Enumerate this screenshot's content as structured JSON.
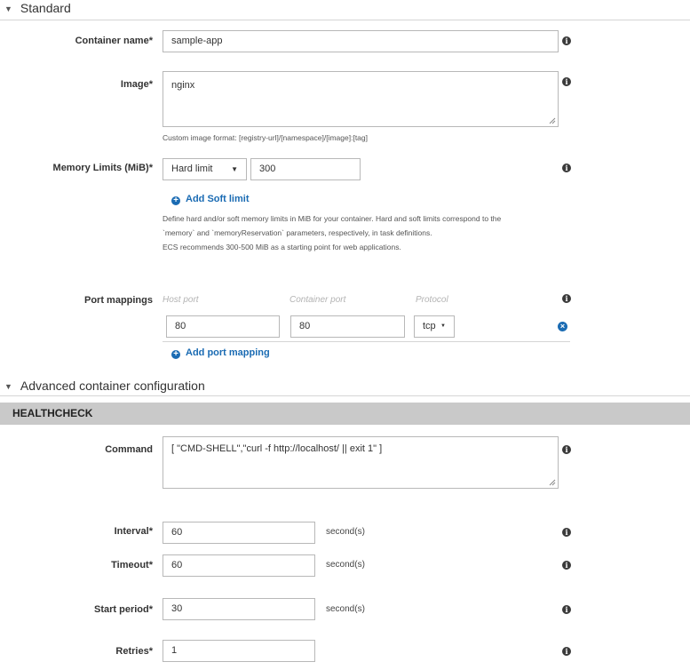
{
  "standard": {
    "section_title": "Standard",
    "container_name": {
      "label": "Container name*",
      "value": "sample-app"
    },
    "image": {
      "label": "Image*",
      "value": "nginx",
      "help": "Custom image format: [registry-url]/[namespace]/[image]:[tag]"
    },
    "memory": {
      "label": "Memory Limits (MiB)*",
      "limit_type": "Hard limit",
      "value": "300",
      "add_soft_limit": "Add Soft limit",
      "help_lines": [
        "Define hard and/or soft memory limits in MiB for your container. Hard and soft limits correspond to the",
        "`memory` and `memoryReservation` parameters, respectively, in task definitions.",
        "ECS recommends 300-500 MiB as a starting point for web applications."
      ]
    },
    "port_mappings": {
      "label": "Port mappings",
      "col_host": "Host port",
      "col_container": "Container port",
      "col_protocol": "Protocol",
      "row": {
        "host": "80",
        "container": "80",
        "protocol": "tcp"
      },
      "add_label": "Add port mapping"
    }
  },
  "advanced": {
    "section_title": "Advanced container configuration",
    "healthcheck": {
      "title": "HEALTHCHECK",
      "command": {
        "label": "Command",
        "value": "[ \"CMD-SHELL\",\"curl -f http://localhost/ || exit 1\" ]"
      },
      "interval": {
        "label": "Interval*",
        "value": "60",
        "unit": "second(s)"
      },
      "timeout": {
        "label": "Timeout*",
        "value": "60",
        "unit": "second(s)"
      },
      "start_period": {
        "label": "Start period*",
        "value": "30",
        "unit": "second(s)"
      },
      "retries": {
        "label": "Retries*",
        "value": "1"
      }
    }
  },
  "icons": {
    "info": "info-icon",
    "plus": "plus-circle-icon",
    "remove": "remove-circle-icon",
    "collapse": "triangle-down-icon",
    "dropdown": "caret-down-icon"
  },
  "colors": {
    "link": "#1a6bb3",
    "healthcheck_bar": "#c9c9c9"
  }
}
